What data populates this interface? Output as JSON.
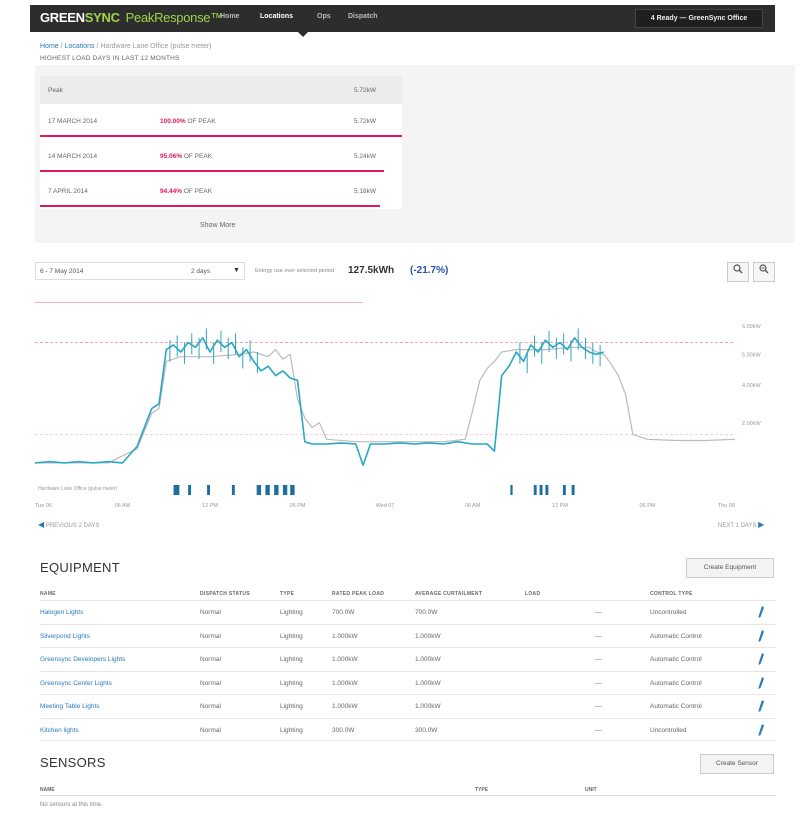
{
  "navbar": {
    "brand_part1": "GREEN",
    "brand_part2": "SYNC",
    "product": "PeakResponse™",
    "items": [
      {
        "label": "Home",
        "active": false
      },
      {
        "label": "Locations",
        "active": true
      },
      {
        "label": "Ops",
        "active": false
      },
      {
        "label": "Dispatch",
        "active": false
      }
    ],
    "site_selector": "4 Ready — GreenSync Office"
  },
  "breadcrumb": {
    "home": "Home",
    "sep1": "/",
    "locations": "Locations",
    "sep2": "/",
    "current": "Hardware Lane Office (pulse meter)"
  },
  "peaks": {
    "title": "HIGHEST LOAD DAYS IN LAST 12 MONTHS",
    "header": {
      "label": "Peak",
      "value": "5.72kW"
    },
    "rows": [
      {
        "date": "17 MARCH 2014",
        "percent": "100.00%",
        "suffix": " OF PEAK",
        "value": "5.72kW",
        "fraction": 1.0
      },
      {
        "date": "14 MARCH 2014",
        "percent": "95.06%",
        "suffix": " OF PEAK",
        "value": "5.24kW",
        "fraction": 0.95
      },
      {
        "date": "7 APRIL 2014",
        "percent": "94.44%",
        "suffix": " OF PEAK",
        "value": "5.18kW",
        "fraction": 0.94
      }
    ],
    "show_more": "Show More"
  },
  "chart_controls": {
    "date_range": "6 - 7 May 2014",
    "days": "2 days",
    "energy_label": "Energy use over selected period",
    "energy_value": "127.5kWh",
    "energy_delta": "(-21.7%)"
  },
  "chart_data": {
    "type": "line",
    "x_ticks": [
      "Tue 06",
      "06 AM",
      "12 PM",
      "06 PM",
      "Wed 07",
      "06 AM",
      "12 PM",
      "06 PM",
      "Thu 08"
    ],
    "y_ticks": [
      "6.00kW",
      "5.00kW",
      "4.00kW",
      "2.00kW"
    ],
    "xlim": [
      0,
      48
    ],
    "ylim": [
      0,
      7.5
    ],
    "series": [
      {
        "color": "#2aa7c3",
        "x": [
          0,
          1,
          2,
          3,
          4,
          5,
          6,
          7,
          8,
          8.5,
          9,
          9.5,
          10,
          10.5,
          11,
          11.5,
          12,
          12.5,
          13,
          13.5,
          14,
          14.5,
          15,
          15.5,
          16,
          16.5,
          17,
          17.5,
          18,
          18.5,
          19,
          20,
          21,
          22,
          22.5,
          23,
          24,
          25,
          26,
          27,
          28,
          29,
          30,
          31,
          31.5,
          32,
          32.5,
          33,
          33.5,
          34,
          34.5,
          35,
          35.5,
          36,
          36.5,
          37,
          37.5,
          38,
          38.5,
          39
        ],
        "y": [
          0.3,
          0.35,
          0.3,
          0.35,
          0.3,
          0.35,
          0.3,
          1.0,
          2.6,
          2.8,
          5.1,
          5.3,
          5.0,
          5.4,
          5.2,
          5.6,
          5.0,
          5.5,
          5.2,
          5.4,
          4.8,
          5.1,
          4.6,
          4.2,
          4.4,
          4.0,
          4.2,
          3.9,
          3.8,
          1.2,
          1.1,
          1.1,
          1.15,
          1.1,
          0.2,
          1.1,
          1.1,
          1.15,
          1.1,
          1.15,
          1.1,
          1.2,
          1.1,
          1.1,
          0.8,
          4.0,
          4.4,
          5.0,
          4.6,
          5.3,
          5.0,
          5.5,
          5.2,
          5.4,
          5.1,
          5.6,
          5.2,
          5.0,
          4.9,
          5.0
        ]
      },
      {
        "color": "#bbbbbb",
        "x": [
          0,
          5,
          7,
          8,
          8.5,
          9,
          10,
          12,
          14,
          15,
          16,
          16.5,
          17,
          17.5,
          18,
          18.5,
          19,
          19.5,
          20,
          22,
          25,
          28,
          29.5,
          30,
          30.5,
          31,
          31.5,
          32,
          33,
          35,
          37,
          38,
          38.5,
          39,
          39.5,
          40,
          40.5,
          41,
          42,
          44,
          46,
          48
        ],
        "y": [
          0.3,
          0.3,
          0.9,
          2.4,
          2.6,
          4.6,
          4.8,
          4.8,
          4.9,
          5.0,
          4.8,
          5.1,
          4.7,
          4.9,
          3.0,
          2.2,
          1.8,
          2.0,
          1.3,
          1.2,
          1.2,
          1.2,
          1.3,
          2.5,
          3.8,
          4.3,
          4.6,
          5.0,
          5.1,
          5.1,
          5.2,
          5.2,
          5.0,
          4.9,
          4.5,
          4.0,
          3.2,
          1.5,
          1.3,
          1.25,
          1.25,
          1.3
        ]
      }
    ],
    "reference_lines": [
      {
        "style": "solid",
        "color": "#f2b6c3",
        "y": 7.1
      },
      {
        "style": "dashed",
        "color": "#f0a8b8",
        "y": 5.4
      },
      {
        "style": "dashed",
        "color": "#f6cdd7",
        "y": 1.5
      }
    ],
    "marker_label": "Hardware Lane Office (pulse meter)"
  },
  "chart_nav": {
    "previous": "PREVIOUS 2 DAYS",
    "next": "NEXT 1 DAYS"
  },
  "equipment": {
    "title": "EQUIPMENT",
    "create_button": "Create Equipment",
    "columns": [
      "NAME",
      "DISPATCH STATUS",
      "TYPE",
      "RATED PEAK LOAD",
      "AVERAGE CURTAILMENT",
      "LOAD",
      "",
      "CONTROL TYPE"
    ],
    "rows": [
      {
        "name": "Halogen Lights",
        "status": "Normal",
        "type": "Lighting",
        "rated": "700.0W",
        "avg": "700.0W",
        "load": "",
        "dash": "—",
        "control": "Uncontrolled"
      },
      {
        "name": "Silverpond Lights",
        "status": "Normal",
        "type": "Lighting",
        "rated": "1.000kW",
        "avg": "1.000kW",
        "load": "",
        "dash": "—",
        "control": "Automatic Control"
      },
      {
        "name": "Greensync Developers Lights",
        "status": "Normal",
        "type": "Lighting",
        "rated": "1.000kW",
        "avg": "1.000kW",
        "load": "",
        "dash": "—",
        "control": "Automatic Control"
      },
      {
        "name": "Greensync Center Lights",
        "status": "Normal",
        "type": "Lighting",
        "rated": "1.000kW",
        "avg": "1.000kW",
        "load": "",
        "dash": "—",
        "control": "Automatic Control"
      },
      {
        "name": "Meeting Table Lights",
        "status": "Normal",
        "type": "Lighting",
        "rated": "1.000kW",
        "avg": "1.000kW",
        "load": "",
        "dash": "—",
        "control": "Automatic Control"
      },
      {
        "name": "Kitchen lights",
        "status": "Normal",
        "type": "Lighting",
        "rated": "300.0W",
        "avg": "300.0W",
        "load": "",
        "dash": "—",
        "control": "Uncontrolled"
      }
    ]
  },
  "sensors": {
    "title": "SENSORS",
    "create_button": "Create Sensor",
    "columns": [
      "NAME",
      "TYPE",
      "UNIT"
    ],
    "empty": "No sensors at this time."
  },
  "colors": {
    "accent": "#e0185a",
    "link": "#2a7ab8",
    "series_primary": "#2aa7c3",
    "series_secondary": "#bbbbbb",
    "nav_bg": "#2d2d2d",
    "brand_green": "#9fd44a"
  }
}
